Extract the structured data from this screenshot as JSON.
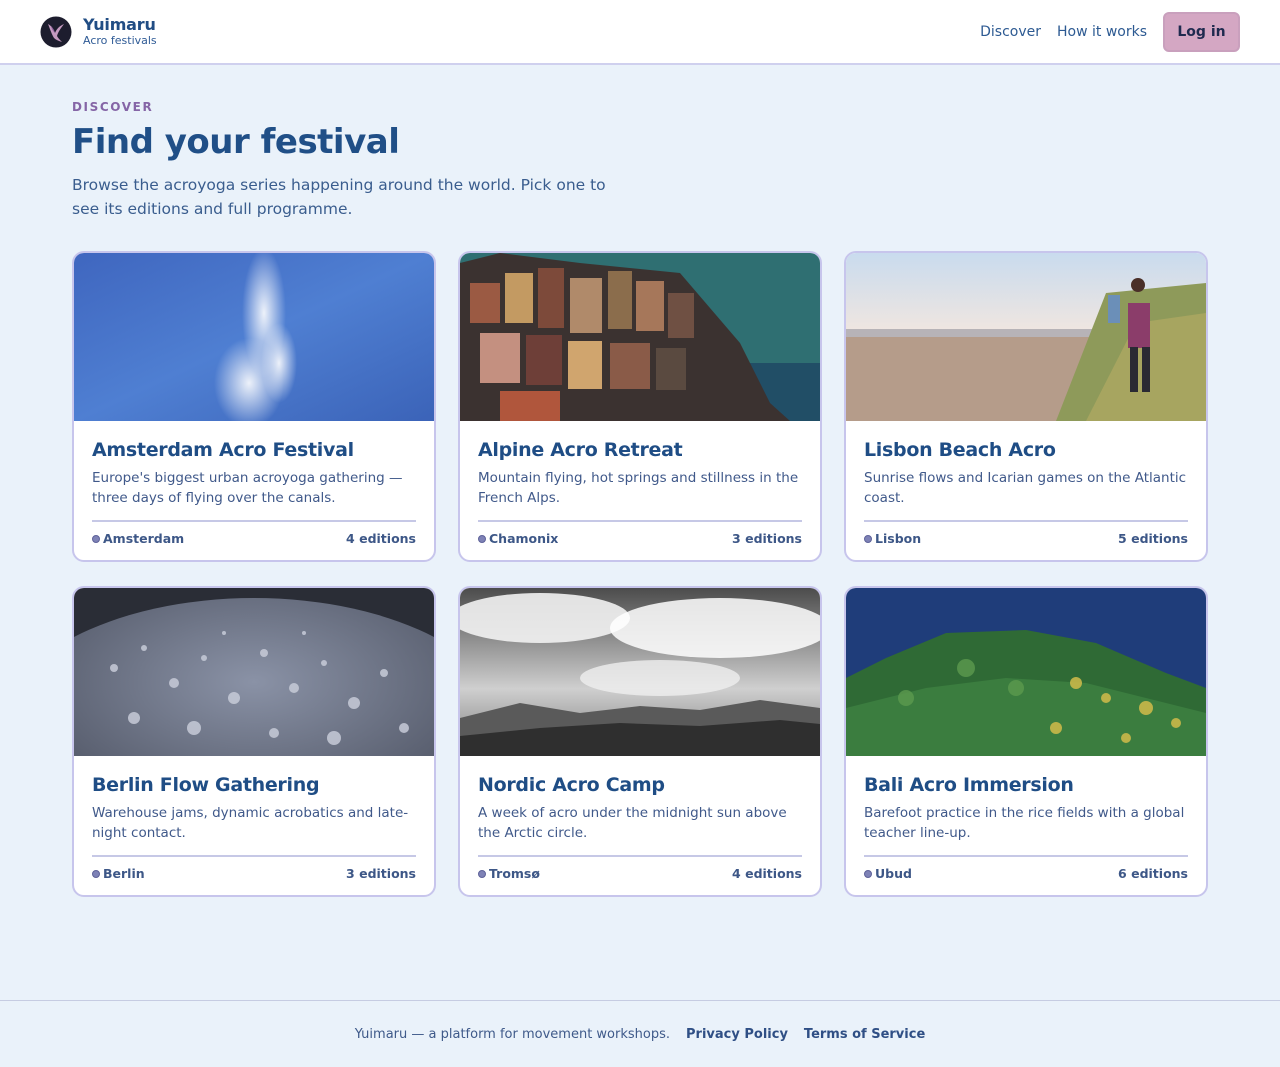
{
  "brand": {
    "name": "Yuimaru",
    "subtitle": "Acro festivals"
  },
  "nav": {
    "discover": "Discover",
    "how_it_works": "How it works",
    "login": "Log in"
  },
  "hero": {
    "eyebrow": "DISCOVER",
    "title": "Find your festival",
    "intro": "Browse the acroyoga series happening around the world. Pick one to see its editions and full programme."
  },
  "festivals": [
    {
      "title": "Amsterdam Acro Festival",
      "description": "Europe's biggest urban acroyoga gathering — three days of flying over the canals.",
      "location": "Amsterdam",
      "editions": "4 editions"
    },
    {
      "title": "Alpine Acro Retreat",
      "description": "Mountain flying, hot springs and stillness in the French Alps.",
      "location": "Chamonix",
      "editions": "3 editions"
    },
    {
      "title": "Lisbon Beach Acro",
      "description": "Sunrise flows and Icarian games on the Atlantic coast.",
      "location": "Lisbon",
      "editions": "5 editions"
    },
    {
      "title": "Berlin Flow Gathering",
      "description": "Warehouse jams, dynamic acrobatics and late-night contact.",
      "location": "Berlin",
      "editions": "3 editions"
    },
    {
      "title": "Nordic Acro Camp",
      "description": "A week of acro under the midnight sun above the Arctic circle.",
      "location": "Tromsø",
      "editions": "4 editions"
    },
    {
      "title": "Bali Acro Immersion",
      "description": "Barefoot practice in the rice fields with a global teacher line-up.",
      "location": "Ubud",
      "editions": "6 editions"
    }
  ],
  "footer": {
    "tagline": "Yuimaru — a platform for movement workshops.",
    "privacy": "Privacy Policy",
    "terms": "Terms of Service"
  },
  "colors": {
    "background": "#eaf2fa",
    "accent": "#d4a7c3",
    "heading": "#204f87",
    "eyebrow": "#8565a6"
  }
}
